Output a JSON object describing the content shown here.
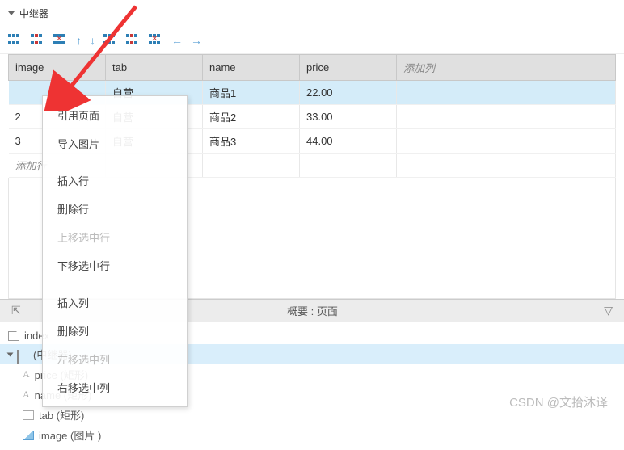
{
  "section": {
    "title": "中继器"
  },
  "table": {
    "headers": {
      "image": "image",
      "tab": "tab",
      "name": "name",
      "price": "price",
      "addcol": "添加列"
    },
    "rows": [
      {
        "idx": "",
        "image": "",
        "tab": "自营",
        "name": "商品1",
        "price": "22.00"
      },
      {
        "idx": "2",
        "image": "",
        "tab": "自营",
        "name": "商品2",
        "price": "33.00"
      },
      {
        "idx": "3",
        "image": "",
        "tab": "自营",
        "name": "商品3",
        "price": "44.00"
      }
    ],
    "addrow": "添加行"
  },
  "context_menu": {
    "items": [
      {
        "label": "引用页面",
        "enabled": true
      },
      {
        "label": "导入图片",
        "enabled": true
      },
      {
        "sep": true
      },
      {
        "label": "插入行",
        "enabled": true
      },
      {
        "label": "删除行",
        "enabled": true
      },
      {
        "label": "上移选中行",
        "enabled": false
      },
      {
        "label": "下移选中行",
        "enabled": true
      },
      {
        "sep": true
      },
      {
        "label": "插入列",
        "enabled": true
      },
      {
        "label": "删除列",
        "enabled": true
      },
      {
        "label": "左移选中列",
        "enabled": false
      },
      {
        "label": "右移选中列",
        "enabled": true
      }
    ]
  },
  "outline": {
    "title": "概要 : 页面"
  },
  "tree": {
    "root": "index",
    "items": [
      {
        "label": "(中继器)"
      },
      {
        "label": "price (矩形)"
      },
      {
        "label": "name (矩形)"
      },
      {
        "label": "tab (矩形)"
      },
      {
        "label": "image (图片 )"
      }
    ]
  },
  "watermark": "CSDN @文拾沐译"
}
